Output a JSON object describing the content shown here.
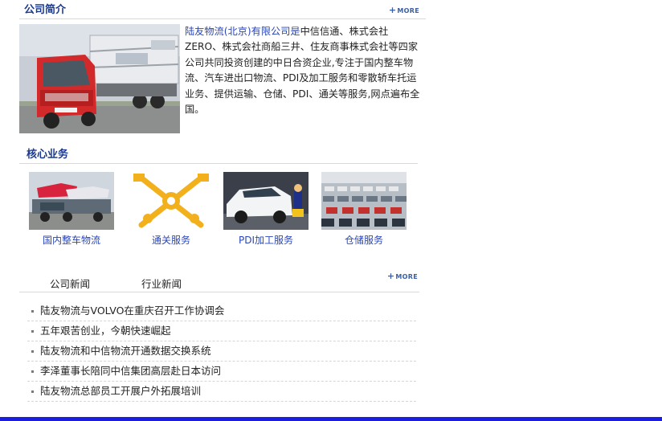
{
  "company_intro": {
    "title": "公司简介",
    "more": "MORE",
    "image": "truck-carrier-photo",
    "company_name": "陆友物流(北京)有限公司是",
    "description": "中信信通、株式会社ZERO、株式会社商船三井、住友商事株式会社等四家公司共同投资创建的中日合资企业,专注于国内整车物流、汽车进出口物流、PDI及加工服务和零散轿车托运业务、提供运输、仓储、PDI、通关等服务,网点遍布全国。"
  },
  "core_business": {
    "title": "核心业务",
    "items": [
      {
        "label": "国内整车物流",
        "image": "car-carrier-truck-photo"
      },
      {
        "label": "通关服务",
        "image": "customs-emblem-icon"
      },
      {
        "label": "PDI加工服务",
        "image": "pdi-car-inspection-photo"
      },
      {
        "label": "仓储服务",
        "image": "car-storage-lot-photo"
      }
    ]
  },
  "news": {
    "tabs": [
      "公司新闻",
      "行业新闻"
    ],
    "more": "MORE",
    "items": [
      "陆友物流与VOLVO在重庆召开工作协调会",
      "五年艰苦创业，今朝快速崛起",
      "陆友物流和中信物流开通数据交换系统",
      "李泽董事长陪同中信集团高层赴日本访问",
      "陆友物流总部员工开展户外拓展培训"
    ]
  },
  "colors": {
    "title_blue": "#1b3a8f",
    "link_blue": "#2a46b5",
    "bottom_bar": "#1d1de0"
  }
}
